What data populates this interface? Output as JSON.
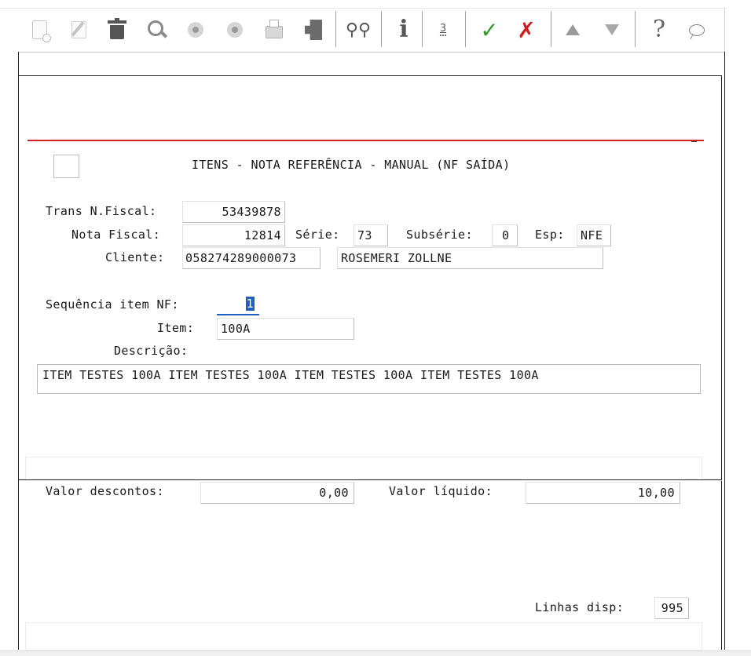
{
  "toolbar": {
    "buttons": [
      {
        "name": "new-record",
        "icon": "new-document-icon",
        "enabled": false
      },
      {
        "name": "edit-record",
        "icon": "edit-icon",
        "enabled": false
      },
      {
        "name": "delete-record",
        "icon": "trash-icon",
        "enabled": true
      },
      {
        "name": "search",
        "icon": "magnifier-icon",
        "enabled": true
      },
      {
        "name": "previous",
        "icon": "previous-circle-icon",
        "enabled": false
      },
      {
        "name": "next",
        "icon": "next-circle-icon",
        "enabled": false
      },
      {
        "name": "print",
        "icon": "printer-icon",
        "enabled": false
      },
      {
        "name": "exit",
        "icon": "exit-door-icon",
        "enabled": true
      },
      {
        "name": "find",
        "icon": "binoculars-icon",
        "enabled": true
      },
      {
        "name": "info",
        "icon": "info-icon",
        "glyph": "i",
        "enabled": true
      },
      {
        "name": "count",
        "icon": "numbered-list-icon",
        "glyph": "3",
        "enabled": true
      },
      {
        "name": "confirm",
        "icon": "checkmark-icon",
        "enabled": true
      },
      {
        "name": "cancel",
        "icon": "red-x-icon",
        "enabled": true
      },
      {
        "name": "move-up",
        "icon": "up-arrow-icon",
        "enabled": false
      },
      {
        "name": "move-down",
        "icon": "down-arrow-icon",
        "enabled": false
      },
      {
        "name": "help",
        "icon": "question-mark-icon",
        "glyph": "?",
        "enabled": true
      },
      {
        "name": "comments",
        "icon": "speech-bubble-icon",
        "enabled": true
      }
    ]
  },
  "form": {
    "title": "ITENS - NOTA REFERÊNCIA - MANUAL (NF SAÍDA)",
    "trans_nf_label": "Trans N.Fiscal:",
    "trans_nf_value": "53439878",
    "nota_fiscal_label": "Nota Fiscal:",
    "nota_fiscal_value": "12814",
    "serie_label": "Série:",
    "serie_value": "73",
    "subserie_label": "Subsérie:",
    "subserie_value": "0",
    "esp_label": "Esp:",
    "esp_value": "NFE",
    "cliente_label": "Cliente:",
    "cliente_code": "058274289000073",
    "cliente_name": "ROSEMERI ZOLLNE",
    "seq_label": "Sequência item NF:",
    "seq_value": "1",
    "item_label": "Item:",
    "item_value": "100A",
    "descricao_label": "Descrição:",
    "descricao_value": "ITEM TESTES 100A ITEM TESTES 100A ITEM TESTES 100A ITEM TESTES 100A"
  },
  "totals": {
    "descontos_label": "Valor descontos:",
    "descontos_value": "0,00",
    "liquido_label": "Valor líquido:",
    "liquido_value": "10,00",
    "linhas_label": "Linhas disp:",
    "linhas_value": "995"
  },
  "colors": {
    "header_rule": "#d42020",
    "focus": "#1f5fbf",
    "confirm": "#2a9a2a",
    "cancel": "#d11d1d"
  }
}
